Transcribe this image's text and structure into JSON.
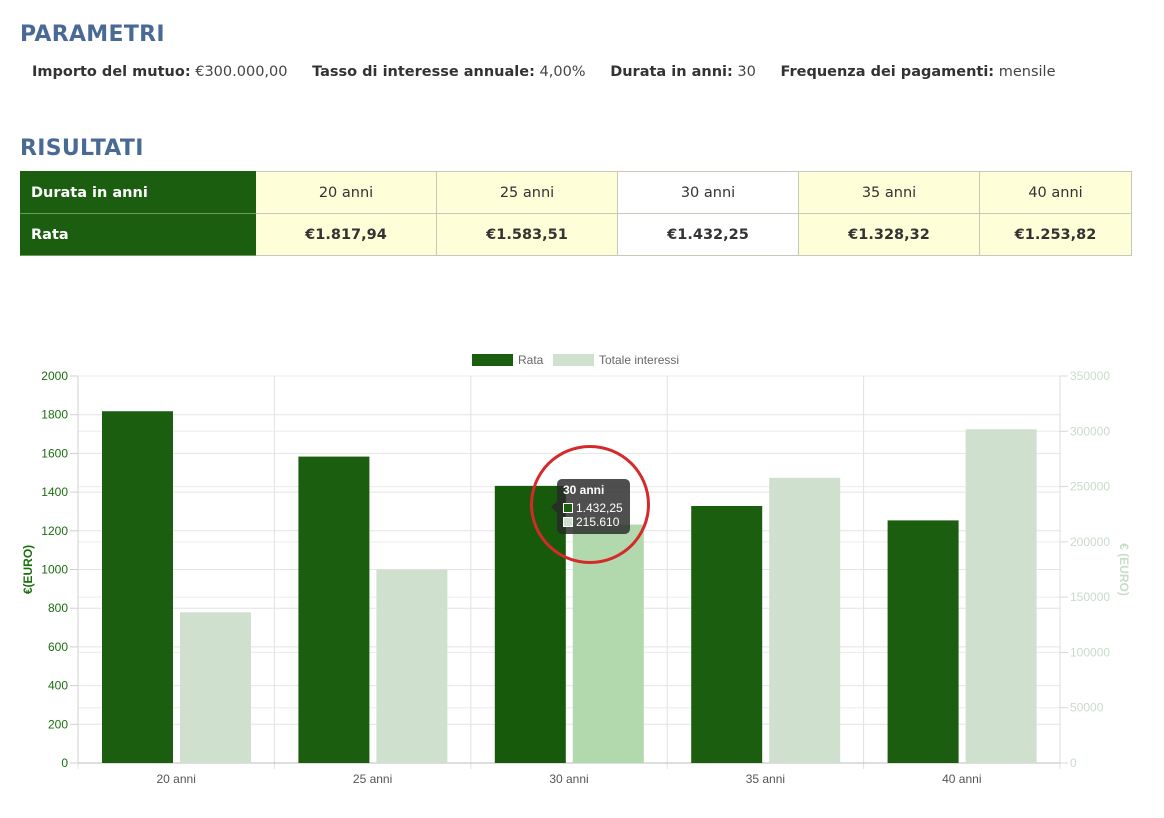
{
  "params_title": "PARAMETRI",
  "params": [
    {
      "label": "Importo del mutuo:",
      "value": "€300.000,00"
    },
    {
      "label": "Tasso di interesse annuale:",
      "value": "4,00%"
    },
    {
      "label": "Durata in anni:",
      "value": "30"
    },
    {
      "label": "Frequenza dei pagamenti:",
      "value": "mensile"
    }
  ],
  "results_title": "RISULTATI",
  "table": {
    "row1_label": "Durata in anni",
    "row2_label": "Rata",
    "durations": [
      "20 anni",
      "25 anni",
      "30 anni",
      "35 anni",
      "40 anni"
    ],
    "rates": [
      "€1.817,94",
      "€1.583,51",
      "€1.432,25",
      "€1.328,32",
      "€1.253,82"
    ],
    "selected_index": 2
  },
  "colors": {
    "rata": "#1b5e0f",
    "rata_active": "#175a0c",
    "interessi": "#cfe0cf",
    "interessi_active": "#b2d8ae",
    "header_bg": "#1b5e0f",
    "cell_bg": "#fefed8",
    "left_axis": "#1b6e0f",
    "right_axis": "#c8dcc8",
    "highlight": "#d42a2a"
  },
  "chart_data": {
    "type": "bar",
    "categories": [
      "20 anni",
      "25 anni",
      "30 anni",
      "35 anni",
      "40 anni"
    ],
    "series": [
      {
        "name": "Rata",
        "axis": "left",
        "values": [
          1817.94,
          1583.51,
          1432.25,
          1328.32,
          1253.82
        ]
      },
      {
        "name": "Totale interessi",
        "axis": "right",
        "values": [
          136305,
          175053,
          215610,
          257894,
          301834
        ]
      }
    ],
    "ylabel_left": "€(EURO)",
    "ylabel_right": "€ (EURO)",
    "ylim_left": [
      0,
      2000
    ],
    "ylim_right": [
      0,
      350000
    ],
    "yticks_left": [
      "0",
      "200",
      "400",
      "600",
      "800",
      "1000",
      "1200",
      "1400",
      "1600",
      "1800",
      "2000"
    ],
    "yticks_right": [
      "0",
      "50000",
      "100000",
      "150000",
      "200000",
      "250000",
      "300000",
      "350000"
    ],
    "grid": true,
    "legend_position": "top",
    "active_category_index": 2,
    "tooltip": {
      "title": "30 anni",
      "rows": [
        "1.432,25",
        "215.610"
      ]
    }
  }
}
